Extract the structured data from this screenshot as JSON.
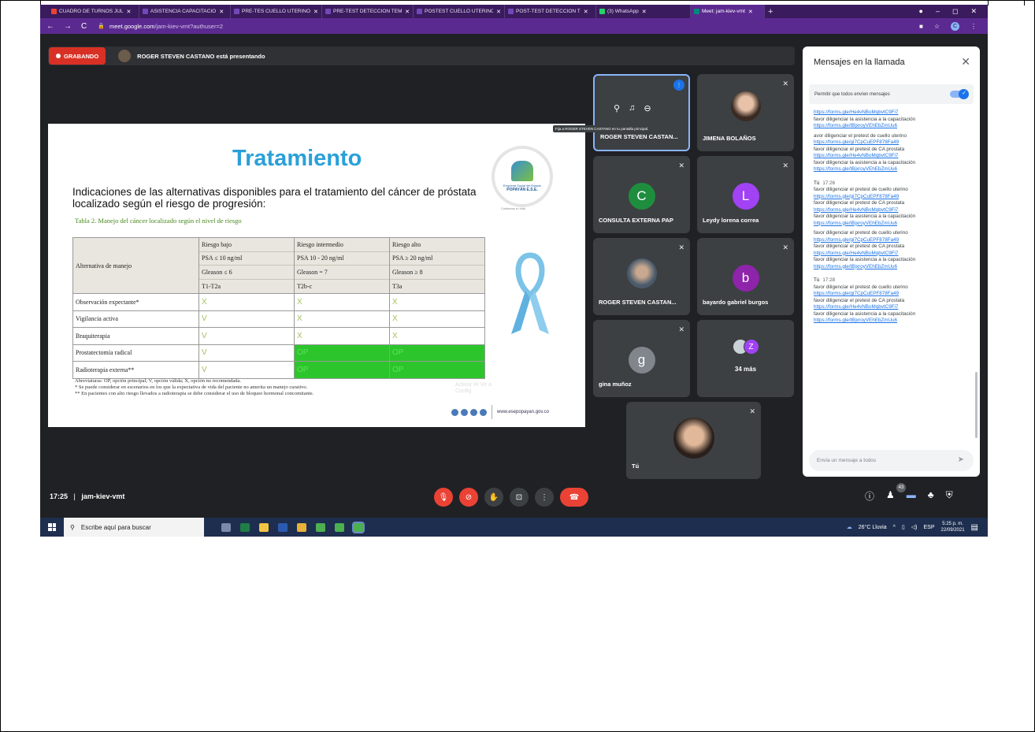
{
  "tabs": [
    {
      "label": "CUADRO DE TURNOS JUL",
      "color": "#ea4335"
    },
    {
      "label": "ASISTENCIA CAPACITACIÓ",
      "color": "#7248b9"
    },
    {
      "label": "PRE-TES CUELLO UTERINO",
      "color": "#7248b9"
    },
    {
      "label": "PRE-TEST DETECCIÓN TEM",
      "color": "#7248b9"
    },
    {
      "label": "POSTEST CUELLO UTERINO",
      "color": "#7248b9"
    },
    {
      "label": "POST-TEST DETECCIÓN T",
      "color": "#7248b9"
    },
    {
      "label": "(3) WhatsApp",
      "color": "#25d366"
    },
    {
      "label": "Meet: jam-kiev-vmt",
      "color": "#00897b"
    }
  ],
  "address": {
    "host": "meet.google.com",
    "path": "/jam-kiev-vmt?authuser=2",
    "profile": "C"
  },
  "presentation": {
    "recording_label": "GRABANDO",
    "presenter_text": "ROGER STEVEN CASTANO está presentando"
  },
  "slide": {
    "title": "Tratamiento",
    "subtitle": "Indicaciones de las alternativas disponibles para el tratamiento del cáncer de próstata localizado según el riesgo de progresión:",
    "caption": "Tabla 2. Manejo del cáncer localizado según el nivel de riesgo",
    "logo_line1": "Empresa Social del Estado",
    "logo_line2": "POPAYÁN E.S.E.",
    "logo_line3": "Cuidamos tu vida",
    "table_header": {
      "col0": "Alternativa de manejo",
      "cols": [
        [
          "Riesgo bajo",
          "PSA ≤ 10 ng/ml",
          "Gleason ≤ 6",
          "T1-T2a"
        ],
        [
          "Riesgo intermedio",
          "PSA 10 - 20 ng/ml",
          "Gleason = 7",
          "T2b-c"
        ],
        [
          "Riesgo alto",
          "PSA ≥ 20 ng/ml",
          "Gleason ≥ 8",
          "T3a"
        ]
      ]
    },
    "table_rows": [
      {
        "label": "Observación expectante*",
        "v": [
          "X",
          "X",
          "X"
        ],
        "green": [
          false,
          false,
          false
        ]
      },
      {
        "label": "Vigilancia activa",
        "v": [
          "V",
          "X",
          "X"
        ],
        "green": [
          false,
          false,
          false
        ]
      },
      {
        "label": "Braquiterapia",
        "v": [
          "V",
          "X",
          "X"
        ],
        "green": [
          false,
          false,
          false
        ]
      },
      {
        "label": "Prostatectomía radical",
        "v": [
          "V",
          "OP",
          "OP"
        ],
        "green": [
          false,
          true,
          true
        ]
      },
      {
        "label": "Radioterapia externa**",
        "v": [
          "V",
          "OP",
          "OP"
        ],
        "green": [
          false,
          true,
          true
        ]
      }
    ],
    "footnotes": [
      "Abreviaturas: OP, opción principal; V, opción válida; X, opción no recomendada.",
      "* Se puede considerar en escenarios en los que la expectativa de vida del paciente no amerita un manejo curativo.",
      "** En pacientes con alto riesgo llevados a radioterapia se debe considerar el uso de bloqueo hormonal concomitante."
    ],
    "watermark": "Activar W Ve a Config",
    "website": "www.esepopayan.gov.co"
  },
  "tooltip": "Fija a ROGER STEVEN CASTANO en tu pantalla principal.",
  "participants": [
    {
      "name": "ROGER STEVEN CASTAN...",
      "kind": "presenting"
    },
    {
      "name": "JIMENA BOLAÑOS",
      "kind": "photo"
    },
    {
      "name": "CONSULTA EXTERNA PAP",
      "initial": "C",
      "color": "#1e8e3e"
    },
    {
      "name": "Leydy lorena correa",
      "initial": "L",
      "color": "#a142f4"
    },
    {
      "name": "ROGER STEVEN CASTAN...",
      "kind": "photo"
    },
    {
      "name": "bayardo gabriel burgos",
      "initial": "b",
      "color": "#8e24aa"
    },
    {
      "name": "gina muñoz",
      "initial": "g",
      "color": "#80868b"
    },
    {
      "name": "34 más",
      "initial": "Z",
      "color": "#a142f4"
    },
    {
      "name": "Tú",
      "kind": "photo"
    }
  ],
  "chat": {
    "title": "Mensajes en la llamada",
    "permission_label": "Permitir que todos envíen mensajes",
    "input_placeholder": "Envía un mensaje a todos",
    "lines": [
      {
        "type": "link",
        "text": "https://forms.gle/He4vNBoMqbvtC9Fi7"
      },
      {
        "type": "text",
        "text": "favor diligenciar la asistencia a la capacitación"
      },
      {
        "type": "link",
        "text": "https://forms.gle/tBjxroyVEhEbZmUu6"
      },
      {
        "type": "gap"
      },
      {
        "type": "text",
        "text": "avor diligenciar el pretest de cuello uterino"
      },
      {
        "type": "link",
        "text": "https://forms.gle/gi7CpCuEPF878Fa49"
      },
      {
        "type": "text",
        "text": "favor diligenciar el pretest de CA prostata"
      },
      {
        "type": "link",
        "text": "https://forms.gle/He4vNBoMqbvtC9Fi7"
      },
      {
        "type": "text",
        "text": "favor diligenciar la asistencia a la capacitación"
      },
      {
        "type": "link",
        "text": "https://forms.gle/tBjxroyVEhEbZmUu6"
      },
      {
        "type": "meta",
        "sender": "Tú",
        "time": "17:26"
      },
      {
        "type": "text",
        "text": "favor diligenciar el pretest de cuello uterino"
      },
      {
        "type": "link",
        "text": "https://forms.gle/gi7CpCuEPF878Fa49"
      },
      {
        "type": "text",
        "text": "favor diligenciar el pretest de CA prostata"
      },
      {
        "type": "link",
        "text": "https://forms.gle/He4vNBoMqbvtC9Fi7"
      },
      {
        "type": "text",
        "text": "favor diligenciar la asistencia a la capacitación"
      },
      {
        "type": "link",
        "text": "https://forms.gle/tBjxroyVEhEbZmUu6"
      },
      {
        "type": "gap"
      },
      {
        "type": "text",
        "text": "favor diligenciar el pretest de cuello uterino"
      },
      {
        "type": "link",
        "text": "https://forms.gle/gi7CpCuEPF878Fa49"
      },
      {
        "type": "text",
        "text": "favor diligenciar el pretest de CA prostata"
      },
      {
        "type": "link",
        "text": "https://forms.gle/He4vNBoMqbvtC9Fi7"
      },
      {
        "type": "text",
        "text": "favor diligenciar la asistencia a la capacitación"
      },
      {
        "type": "link",
        "text": "https://forms.gle/tBjxroyVEhEbZmUu6"
      },
      {
        "type": "meta",
        "sender": "Tú",
        "time": "17:28"
      },
      {
        "type": "text",
        "text": "favor diligenciar el pretest de cuello uterino"
      },
      {
        "type": "link",
        "text": "https://forms.gle/gi7CpCuEPF878Fa49"
      },
      {
        "type": "text",
        "text": "favor diligenciar el pretest de CA prostata"
      },
      {
        "type": "link",
        "text": "https://forms.gle/He4vNBoMqbvtC9Fi7"
      },
      {
        "type": "text",
        "text": "favor diligenciar la asistencia a la capacitación"
      },
      {
        "type": "link",
        "text": "https://forms.gle/tBjxroyVEhEbZmUu6"
      }
    ]
  },
  "meeting": {
    "time": "17:25",
    "code": "jam-kiev-vmt",
    "separator": "|",
    "participant_count": "43"
  },
  "taskbar": {
    "search_placeholder": "Escribe aquí para buscar",
    "weather": "26°C Lluvia",
    "lang": "ESP",
    "time": "5:25 p. m.",
    "date": "22/09/2021"
  }
}
